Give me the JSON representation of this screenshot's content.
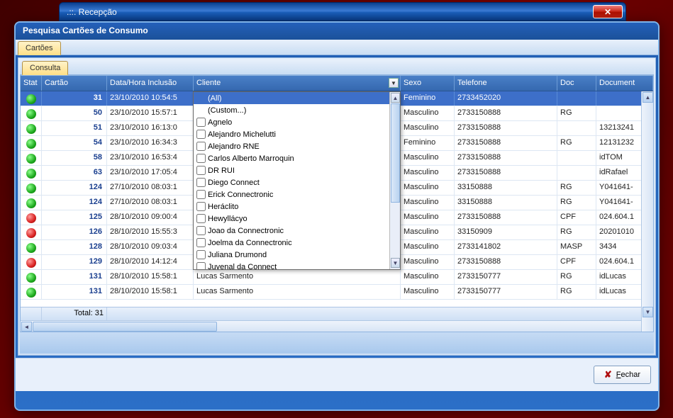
{
  "outer": {
    "title": ".::. Recepção"
  },
  "window": {
    "title": "Pesquisa Cartões de Consumo"
  },
  "tabs": {
    "cartoes": "Cartões",
    "consulta": "Consulta"
  },
  "columns": {
    "stat": "Stat",
    "cartao": "Cartão",
    "data": "Data/Hora Inclusão",
    "cliente": "Cliente",
    "sexo": "Sexo",
    "telefone": "Telefone",
    "doc": "Doc",
    "documento": "Document"
  },
  "rows": [
    {
      "status": "green",
      "cartao": "31",
      "data": "23/10/2010 10:54:5",
      "sexo": "Feminino",
      "tel": "2733452020",
      "doc": "",
      "docnum": ""
    },
    {
      "status": "green",
      "cartao": "50",
      "data": "23/10/2010 15:57:1",
      "sexo": "Masculino",
      "tel": "2733150888",
      "doc": "RG",
      "docnum": ""
    },
    {
      "status": "green",
      "cartao": "51",
      "data": "23/10/2010 16:13:0",
      "sexo": "Masculino",
      "tel": "2733150888",
      "doc": "",
      "docnum": "13213241"
    },
    {
      "status": "green",
      "cartao": "54",
      "data": "23/10/2010 16:34:3",
      "sexo": "Feminino",
      "tel": "2733150888",
      "doc": "RG",
      "docnum": "12131232"
    },
    {
      "status": "green",
      "cartao": "58",
      "data": "23/10/2010 16:53:4",
      "sexo": "Masculino",
      "tel": "2733150888",
      "doc": "",
      "docnum": "idTOM"
    },
    {
      "status": "green",
      "cartao": "63",
      "data": "23/10/2010 17:05:4",
      "sexo": "Masculino",
      "tel": "2733150888",
      "doc": "",
      "docnum": "idRafael"
    },
    {
      "status": "green",
      "cartao": "124",
      "data": "27/10/2010 08:03:1",
      "sexo": "Masculino",
      "tel": "33150888",
      "doc": "RG",
      "docnum": "Y041641-"
    },
    {
      "status": "green",
      "cartao": "124",
      "data": "27/10/2010 08:03:1",
      "sexo": "Masculino",
      "tel": "33150888",
      "doc": "RG",
      "docnum": "Y041641-"
    },
    {
      "status": "red",
      "cartao": "125",
      "data": "28/10/2010 09:00:4",
      "sexo": "Masculino",
      "tel": "2733150888",
      "doc": "CPF",
      "docnum": "024.604.1"
    },
    {
      "status": "red",
      "cartao": "126",
      "data": "28/10/2010 15:55:3",
      "sexo": "Masculino",
      "tel": "33150909",
      "doc": "RG",
      "docnum": "20201010"
    },
    {
      "status": "green",
      "cartao": "128",
      "data": "28/10/2010 09:03:4",
      "sexo": "Masculino",
      "tel": "2733141802",
      "doc": "MASP",
      "docnum": "3434"
    },
    {
      "status": "red",
      "cartao": "129",
      "data": "28/10/2010 14:12:4",
      "sexo": "Masculino",
      "tel": "2733150888",
      "doc": "CPF",
      "docnum": "024.604.1"
    },
    {
      "status": "green",
      "cartao": "131",
      "data": "28/10/2010 15:58:1",
      "cliente": "Lucas Sarmento",
      "sexo": "Masculino",
      "tel": "2733150777",
      "doc": "RG",
      "docnum": "idLucas"
    },
    {
      "status": "green",
      "cartao": "131",
      "data": "28/10/2010 15:58:1",
      "cliente": "Lucas Sarmento",
      "sexo": "Masculino",
      "tel": "2733150777",
      "doc": "RG",
      "docnum": "idLucas"
    }
  ],
  "footer": {
    "total": "Total: 31"
  },
  "filter": {
    "all": "(All)",
    "custom": "(Custom...)",
    "items": [
      "Agnelo",
      "Alejandro Michelutti",
      "Alejandro RNE",
      "Carlos Alberto Marroquin",
      "DR RUI",
      "Diego Connect",
      "Erick Connectronic",
      "Heráclito",
      "Hewyllácyo",
      "Joao da Connectronic",
      "Joelma da Connectronic",
      "Juliana Drumond",
      "Juvenal da Connect"
    ]
  },
  "buttons": {
    "fechar": "Fechar"
  }
}
